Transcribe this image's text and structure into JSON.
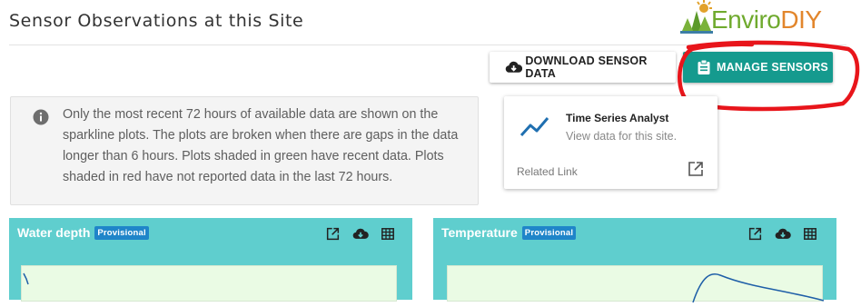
{
  "header": {
    "title": "Sensor Observations at this Site",
    "logo": {
      "part1": "Enviro",
      "part2": "DIY"
    }
  },
  "actions": {
    "download_label": "DOWNLOAD SENSOR DATA",
    "manage_label": "MANAGE SENSORS"
  },
  "info": {
    "text": "Only the most recent 72 hours of available data are shown on the sparkline plots. The plots are broken when there are gaps in the data longer than 6 hours. Plots shaded in green have recent data. Plots shaded in red have not reported data in the last 72 hours."
  },
  "related_card": {
    "title": "Time Series Analyst",
    "subtitle": "View data for this site.",
    "footer": "Related Link"
  },
  "panels": [
    {
      "name": "Water depth",
      "badge": "Provisional"
    },
    {
      "name": "Temperature",
      "badge": "Provisional"
    }
  ],
  "colors": {
    "teal_header": "#5fcece",
    "manage_button": "#159a8e",
    "badge": "#1f85c9",
    "recent_data_shade": "#eafbe4",
    "annotation": "#e8151b",
    "logo_green": "#6faa2e",
    "logo_orange": "#e2862c"
  },
  "icons": {
    "download": "cloud-download-icon",
    "manage": "clipboard-icon",
    "info": "info-circle-icon",
    "trend": "trend-line-icon",
    "external": "external-link-icon",
    "table": "table-icon"
  }
}
